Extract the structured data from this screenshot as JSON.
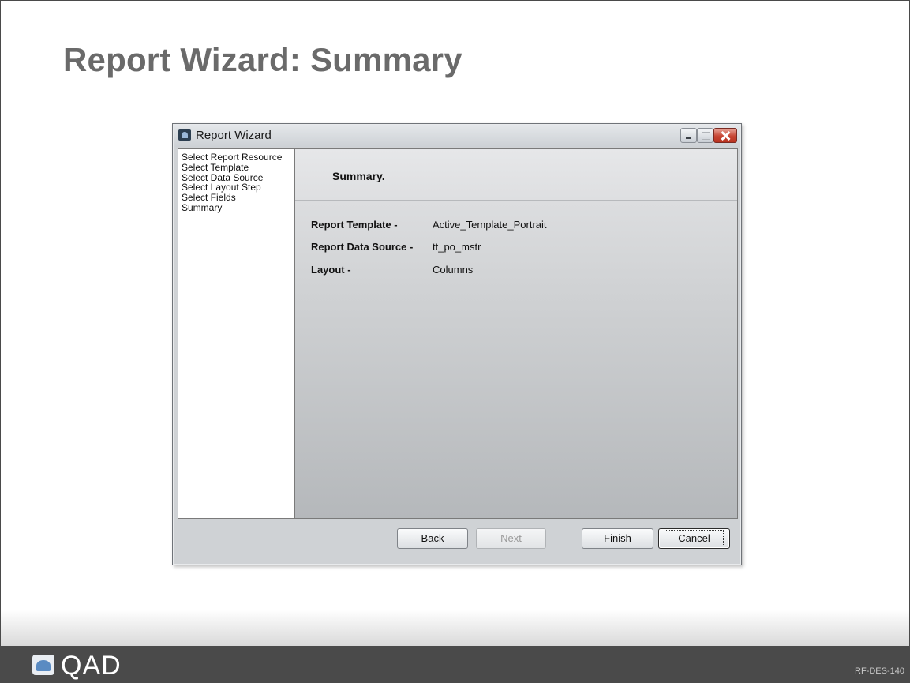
{
  "slide": {
    "title": "Report Wizard: Summary",
    "footer": {
      "logo_text": "QAD",
      "code": "RF-DES-140"
    }
  },
  "window": {
    "title": "Report Wizard",
    "icon": "report-wizard-app-icon",
    "steps": [
      "Select Report Resource",
      "Select Template",
      "Select Data Source",
      "Select Layout Step",
      "Select Fields",
      "Summary"
    ],
    "heading": "Summary.",
    "summary": {
      "template_label": "Report Template -",
      "template_value": "Active_Template_Portrait",
      "datasource_label": "Report Data Source -",
      "datasource_value": "tt_po_mstr",
      "layout_label": "Layout -",
      "layout_value": "Columns"
    },
    "buttons": {
      "back": "Back",
      "next": "Next",
      "finish": "Finish",
      "cancel": "Cancel"
    }
  }
}
